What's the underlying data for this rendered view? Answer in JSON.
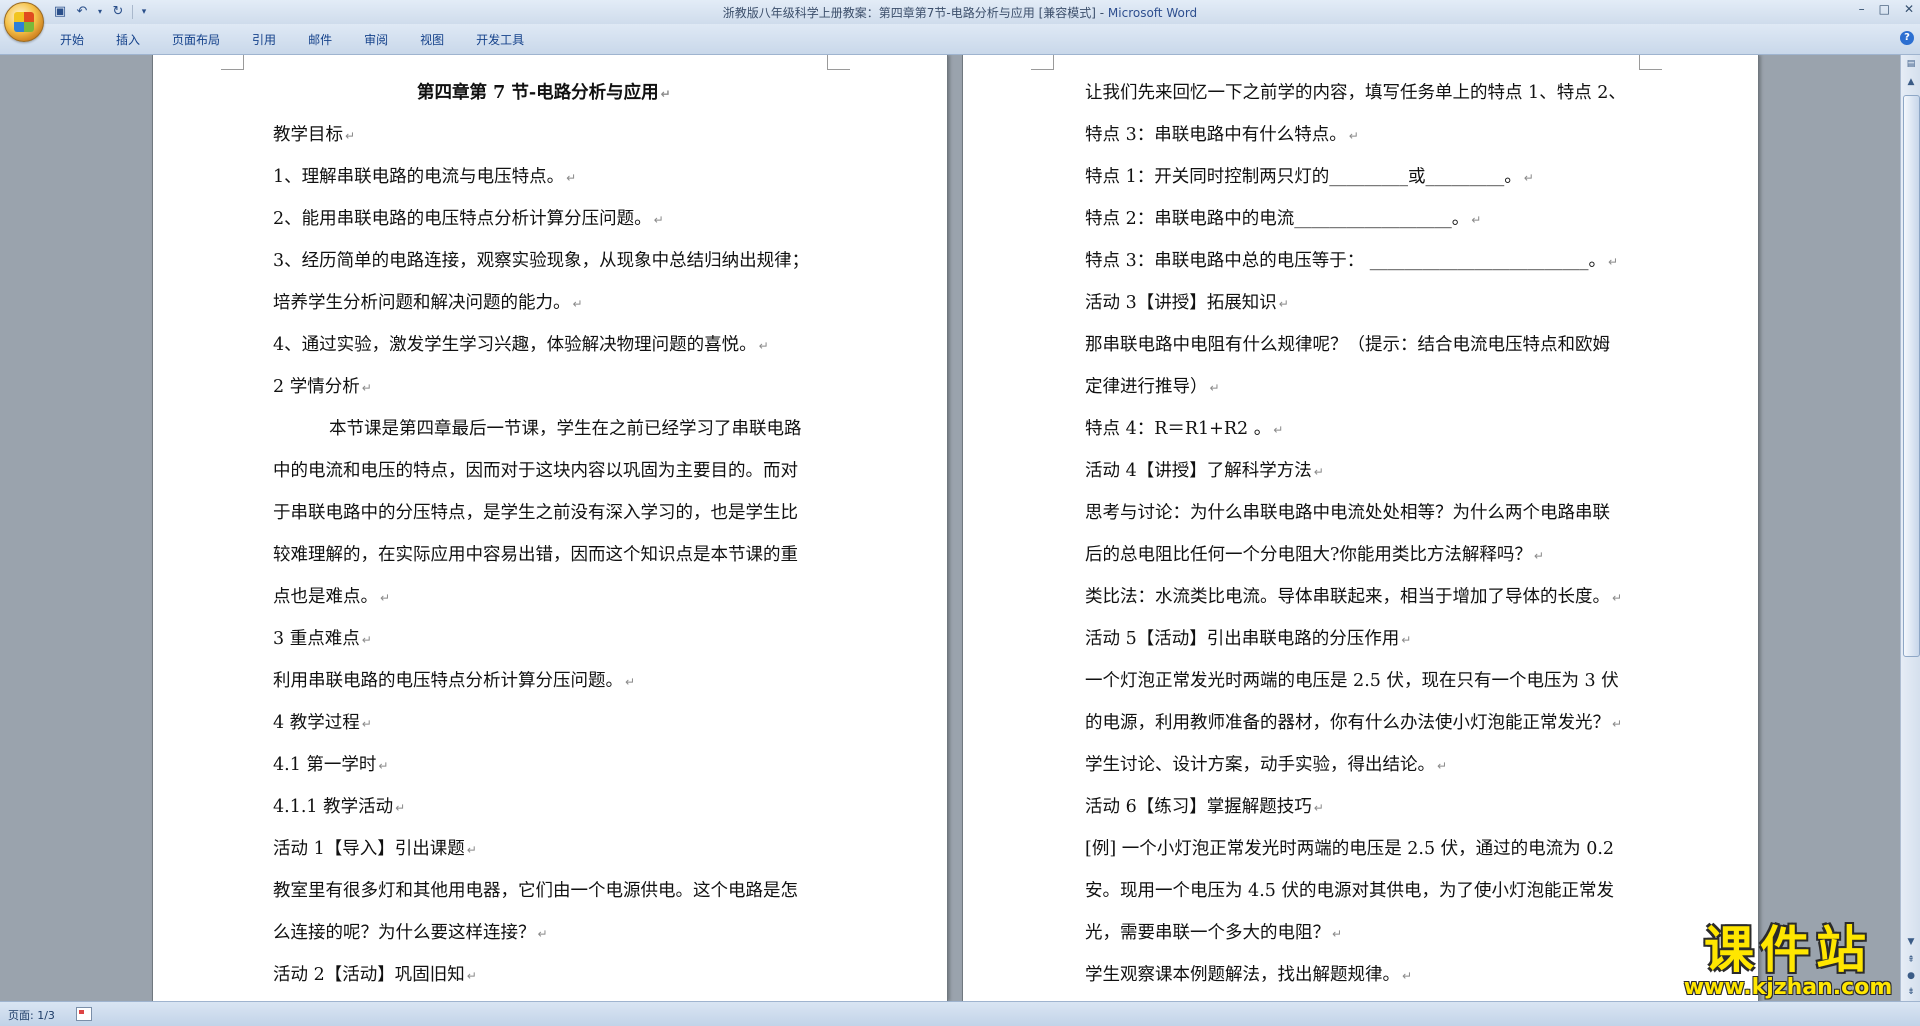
{
  "window": {
    "title_doc": "浙教版八年级科学上册教案：第四章第7节-电路分析与应用 [兼容模式] - ",
    "title_app": "Microsoft Word"
  },
  "ribbon": {
    "tabs": [
      "开始",
      "插入",
      "页面布局",
      "引用",
      "邮件",
      "审阅",
      "视图",
      "开发工具"
    ]
  },
  "left_page": {
    "title": "第四章第 7 节-电路分析与应用",
    "lines": [
      "教学目标",
      "1、理解串联电路的电流与电压特点。",
      "2、能用串联电路的电压特点分析计算分压问题。",
      "3、经历简单的电路连接，观察实验现象，从现象中总结归纳出规律；",
      "培养学生分析问题和解决问题的能力。",
      "4、通过实验，激发学生学习兴趣，体验解决物理问题的喜悦。",
      "2 学情分析",
      "本节课是第四章最后一节课，学生在之前已经学习了串联电路",
      "中的电流和电压的特点，因而对于这块内容以巩固为主要目的。而对",
      "于串联电路中的分压特点，是学生之前没有深入学习的，也是学生比",
      "较难理解的，在实际应用中容易出错，因而这个知识点是本节课的重",
      "点也是难点。",
      "3 重点难点",
      "利用串联电路的电压特点分析计算分压问题。",
      "4 教学过程",
      "4.1 第一学时",
      "4.1.1 教学活动",
      "活动 1【导入】引出课题",
      "教室里有很多灯和其他用电器，它们由一个电源供电。这个电路是怎",
      "么连接的呢？为什么要这样连接？",
      "活动 2【活动】巩固旧知"
    ]
  },
  "right_page": {
    "lines": [
      "让我们先来回忆一下之前学的内容，填写任务单上的特点 1、特点 2、",
      "特点 3：串联电路中有什么特点。",
      "特点 1：开关同时控制两只灯的_________或_________。",
      "特点 2：串联电路中的电流__________________。",
      "特点 3：串联电路中总的电压等于：  _________________________。",
      "活动 3【讲授】拓展知识",
      "那串联电路中电阻有什么规律呢？（提示：结合电流电压特点和欧姆",
      "定律进行推导）",
      "特点 4：R＝R1+R2  。",
      "活动 4【讲授】了解科学方法",
      "思考与讨论：为什么串联电路中电流处处相等？为什么两个电路串联",
      "后的总电阻比任何一个分电阻大?你能用类比方法解释吗？",
      "类比法：水流类比电流。导体串联起来，相当于增加了导体的长度。",
      "活动 5【活动】引出串联电路的分压作用",
      "一个灯泡正常发光时两端的电压是 2.5 伏，现在只有一个电压为 3 伏",
      "的电源，利用教师准备的器材，你有什么办法使小灯泡能正常发光？",
      "学生讨论、设计方案，动手实验，得出结论。",
      "活动 6【练习】掌握解题技巧",
      "[例] 一个小灯泡正常发光时两端的电压是 2.5 伏，通过的电流为 0.2",
      "安。现用一个电压为 4.5 伏的电源对其供电，为了使小灯泡能正常发",
      "光，需要串联一个多大的电阻？",
      "学生观察课本例题解法，找出解题规律。"
    ]
  },
  "statusbar": {
    "page": "页面: 1/3"
  },
  "watermark": {
    "main": "课件站",
    "url": "www.kjzhan.com"
  },
  "colors": {
    "ribbon_text": "#15428b",
    "watermark": "#ffe600",
    "page_bg": "#ffffff",
    "workspace": "#9aa3ad"
  }
}
